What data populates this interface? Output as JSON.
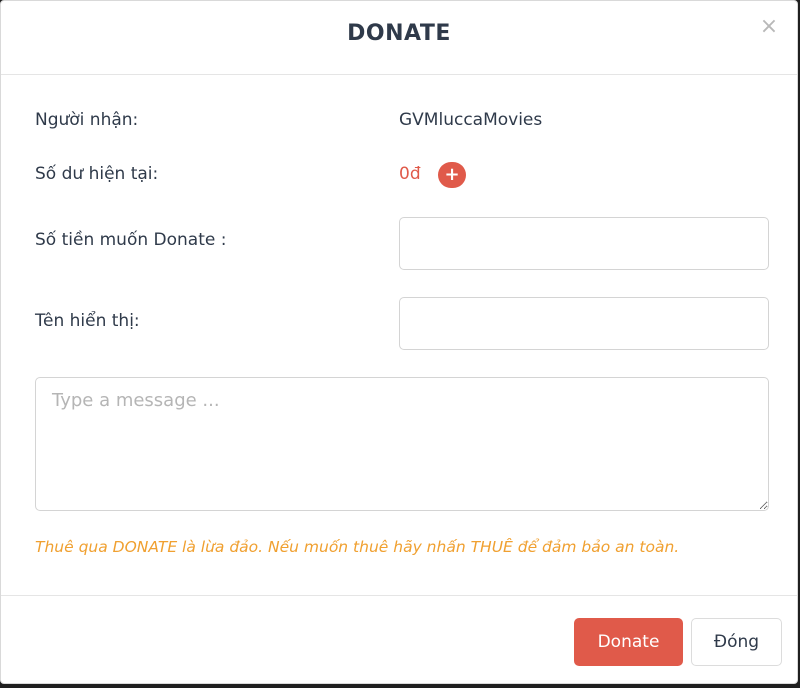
{
  "modal": {
    "title": "DONATE",
    "close_icon": "×"
  },
  "recipient": {
    "label": "Người nhận:",
    "value": "GVMluccaMovies"
  },
  "balance": {
    "label": "Số dư hiện tại:",
    "value": "0đ",
    "add_icon": "+"
  },
  "amount": {
    "label": "Số tiền muốn Donate :",
    "value": "",
    "placeholder": ""
  },
  "display_name": {
    "label": "Tên hiển thị:",
    "value": "",
    "placeholder": ""
  },
  "message": {
    "placeholder": "Type a message ..."
  },
  "warning_text": "Thuê qua DONATE là lừa đảo. Nếu muốn thuê hãy nhấn THUÊ để đảm bảo an toàn.",
  "footer": {
    "donate_label": "Donate",
    "close_label": "Đóng"
  },
  "colors": {
    "accent": "#e05a4a",
    "warning": "#f0a030",
    "text": "#2f3a4a"
  }
}
